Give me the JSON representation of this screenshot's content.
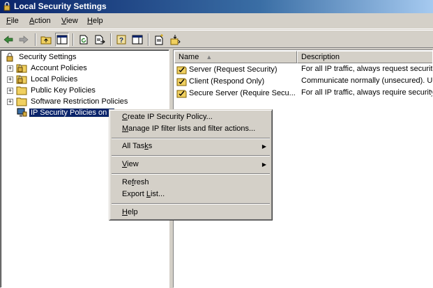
{
  "window": {
    "title": "Local Security Settings",
    "icon": "security-settings-icon"
  },
  "menubar": {
    "items": [
      "File",
      "Action",
      "View",
      "Help"
    ]
  },
  "toolbar": {
    "buttons": [
      "back-arrow-icon",
      "forward-arrow-icon",
      "up-folder-icon",
      "show-hide-tree-icon",
      "refresh-icon",
      "export-list-icon",
      "help-icon",
      "properties-icon",
      "new-policy-icon",
      "assign-icon"
    ]
  },
  "tree": {
    "root": "Security Settings",
    "items": [
      {
        "label": "Account Policies",
        "expander": "+"
      },
      {
        "label": "Local Policies",
        "expander": "+"
      },
      {
        "label": "Public Key Policies",
        "expander": "+"
      },
      {
        "label": "Software Restriction Policies",
        "expander": "+"
      },
      {
        "label": "IP Security Policies on L",
        "selected": true
      }
    ]
  },
  "list": {
    "columns": [
      "Name",
      "Description"
    ],
    "rows": [
      {
        "name": "Server (Request Security)",
        "description": "For all IP traffic, always request securit"
      },
      {
        "name": "Client (Respond Only)",
        "description": "Communicate normally (unsecured). Us."
      },
      {
        "name": "Secure Server (Require Secu...",
        "description": "For all IP traffic, always require security"
      }
    ]
  },
  "context_menu": {
    "items": [
      {
        "label": "Create IP Security Policy...",
        "u": "C",
        "rest": "reate IP Security Policy..."
      },
      {
        "label": "Manage IP filter lists and filter actions...",
        "u": "M",
        "rest": "anage IP filter lists and filter actions..."
      },
      {
        "label": "All Tasks",
        "pre": "All Tas",
        "u": "k",
        "rest": "s",
        "submenu": true
      },
      {
        "label": "View",
        "u": "V",
        "rest": "iew",
        "submenu": true
      },
      {
        "label": "Refresh",
        "pre": "Re",
        "u": "f",
        "rest": "resh"
      },
      {
        "label": "Export List...",
        "pre": "Export ",
        "u": "L",
        "rest": "ist..."
      },
      {
        "label": "Help",
        "u": "H",
        "rest": "elp"
      }
    ]
  },
  "colors": {
    "selection": "#0a246a",
    "face": "#d4d0c8",
    "title_start": "#0a246a"
  }
}
